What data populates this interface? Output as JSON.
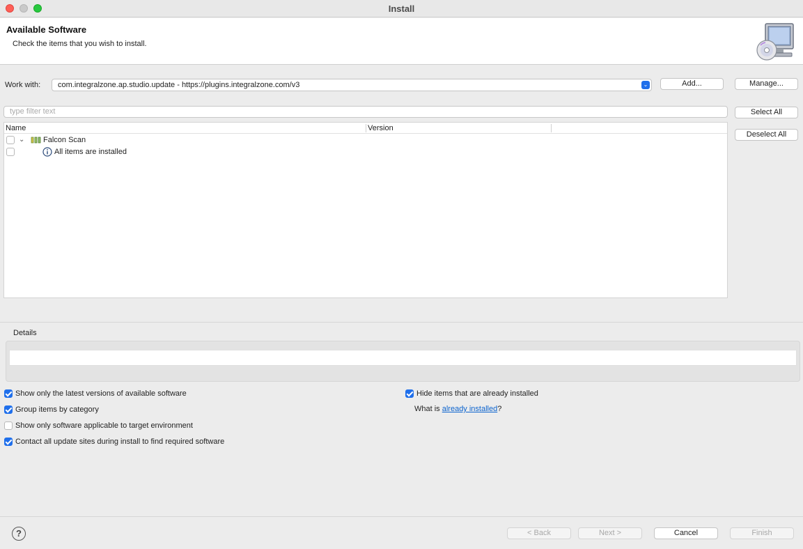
{
  "window": {
    "title": "Install"
  },
  "header": {
    "title": "Available Software",
    "description": "Check the items that you wish to install."
  },
  "work_with": {
    "label": "Work with:",
    "value": "com.integralzone.ap.studio.update - https://plugins.integralzone.com/v3",
    "add_label": "Add...",
    "manage_label": "Manage..."
  },
  "filter": {
    "placeholder": "type filter text"
  },
  "side_buttons": {
    "select_all": "Select All",
    "deselect_all": "Deselect All"
  },
  "tree": {
    "columns": [
      "Name",
      "Version"
    ],
    "rows": [
      {
        "name": "Falcon Scan",
        "version": "",
        "expanded": true,
        "checked": false
      },
      {
        "name": "All items are installed",
        "version": "",
        "checked": false
      }
    ]
  },
  "details": {
    "label": "Details"
  },
  "options": {
    "show_latest": {
      "label": "Show only the latest versions of available software",
      "checked": true
    },
    "group_by_category": {
      "label": "Group items by category",
      "checked": true
    },
    "show_applicable": {
      "label": "Show only software applicable to target environment",
      "checked": false
    },
    "contact_all_sites": {
      "label": "Contact all update sites during install to find required software",
      "checked": true
    },
    "hide_installed": {
      "label": "Hide items that are already installed",
      "checked": true
    },
    "what_is_prefix": "What is ",
    "what_is_link": "already installed",
    "what_is_suffix": "?"
  },
  "footer": {
    "help": "?",
    "back": "< Back",
    "next": "Next >",
    "cancel": "Cancel",
    "finish": "Finish"
  },
  "colors": {
    "accent": "#1f6feb",
    "link": "#0b63ce"
  }
}
